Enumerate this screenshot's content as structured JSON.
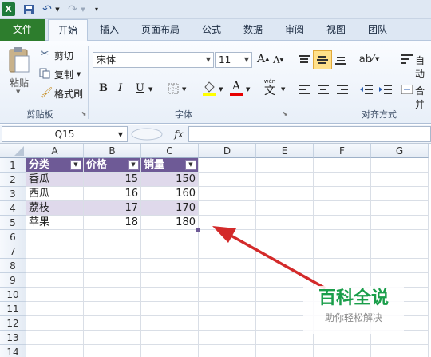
{
  "colors": {
    "file_tab": "#2d7d2d",
    "table_header": "#6e5a96",
    "table_band": "#dfd9eb",
    "arrow": "#d32a2a",
    "watermark": "#1a9e4a"
  },
  "tabs": [
    {
      "label": "文件"
    },
    {
      "label": "开始"
    },
    {
      "label": "插入"
    },
    {
      "label": "页面布局"
    },
    {
      "label": "公式"
    },
    {
      "label": "数据"
    },
    {
      "label": "审阅"
    },
    {
      "label": "视图"
    },
    {
      "label": "团队"
    }
  ],
  "clipboard": {
    "paste": "粘贴",
    "cut": "剪切",
    "copy": "复制",
    "format_painter": "格式刷",
    "group": "剪贴板"
  },
  "font": {
    "name": "宋体",
    "size": "11",
    "grow": "A",
    "shrink": "A",
    "bold": "B",
    "italic": "I",
    "underline": "U",
    "font_color": "A",
    "phonetic": "wén",
    "phonetic_char": "文",
    "group": "字体"
  },
  "alignment": {
    "group": "对齐方式",
    "wrap": "自动",
    "merge": "合并"
  },
  "formula_bar": {
    "name_box": "Q15",
    "fx": "fx"
  },
  "columns": [
    "A",
    "B",
    "C",
    "D",
    "E",
    "F",
    "G"
  ],
  "rows": [
    "1",
    "2",
    "3",
    "4",
    "5",
    "6",
    "7",
    "8",
    "9",
    "10",
    "11",
    "12",
    "13",
    "14"
  ],
  "table": {
    "headers": [
      "分类",
      "价格",
      "销量"
    ],
    "rows": [
      [
        "香瓜",
        "15",
        "150"
      ],
      [
        "西瓜",
        "16",
        "160"
      ],
      [
        "荔枝",
        "17",
        "170"
      ],
      [
        "苹果",
        "18",
        "180"
      ]
    ]
  },
  "watermark": {
    "title": "百科全说",
    "subtitle": "助你轻松解决"
  }
}
